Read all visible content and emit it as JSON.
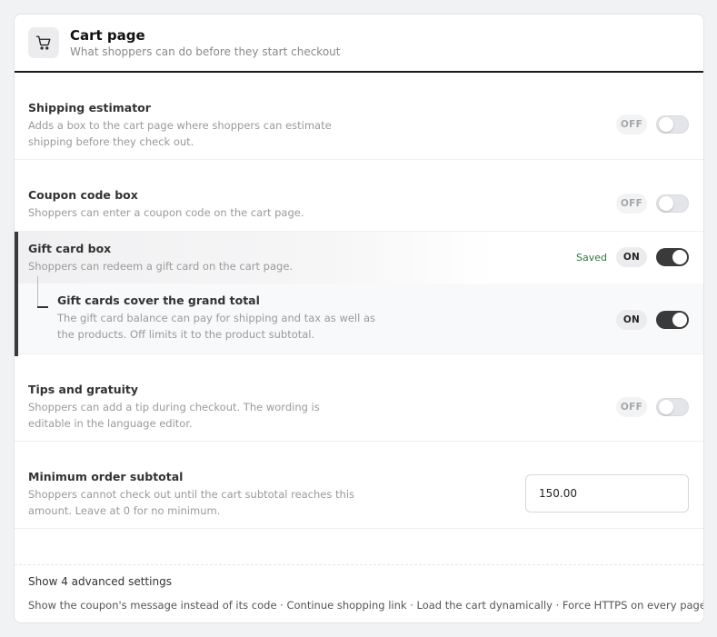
{
  "header": {
    "icon": "cart-icon",
    "title": "Cart page",
    "subtitle": "What shoppers can do before they start checkout"
  },
  "settings": {
    "shipping_estimator": {
      "label": "Shipping estimator",
      "desc_1": "Adds a box to the cart page where shoppers can estimate",
      "desc_2": "shipping before they check out.",
      "state": "OFF"
    },
    "coupon_code_box": {
      "label": "Coupon code box",
      "desc_1": "Shoppers can enter a coupon code on the cart page.",
      "state": "OFF"
    },
    "gift_card_box": {
      "label": "Gift card box",
      "desc_1": "Shoppers can redeem a gift card on the cart page.",
      "status": "Saved",
      "state": "ON",
      "sub": {
        "label": "Gift cards cover the grand total",
        "desc_1": "The gift card balance can pay for shipping and tax as well as",
        "desc_2": "the products. Off limits it to the product subtotal.",
        "state": "ON"
      }
    },
    "tips_gratuity": {
      "label": "Tips and gratuity",
      "desc_1": "Shoppers can add a tip during checkout. The wording is",
      "desc_2": "editable in the language editor.",
      "state": "OFF"
    },
    "minimum_order": {
      "label": "Minimum order subtotal",
      "desc_1": "Shoppers cannot check out until the cart subtotal reaches this",
      "desc_2": "amount. Leave at 0 for no minimum.",
      "value": "150.00"
    }
  },
  "footer": {
    "advanced_link": "Show 4 advanced settings",
    "advanced_list": "Show the coupon's message instead of its code · Continue shopping link · Load the cart dynamically · Force HTTPS on every page"
  },
  "colors": {
    "toggle_on": "#3a3a3a",
    "saved_text": "#2d7a3a",
    "header_rule": "#1a1a1a"
  }
}
